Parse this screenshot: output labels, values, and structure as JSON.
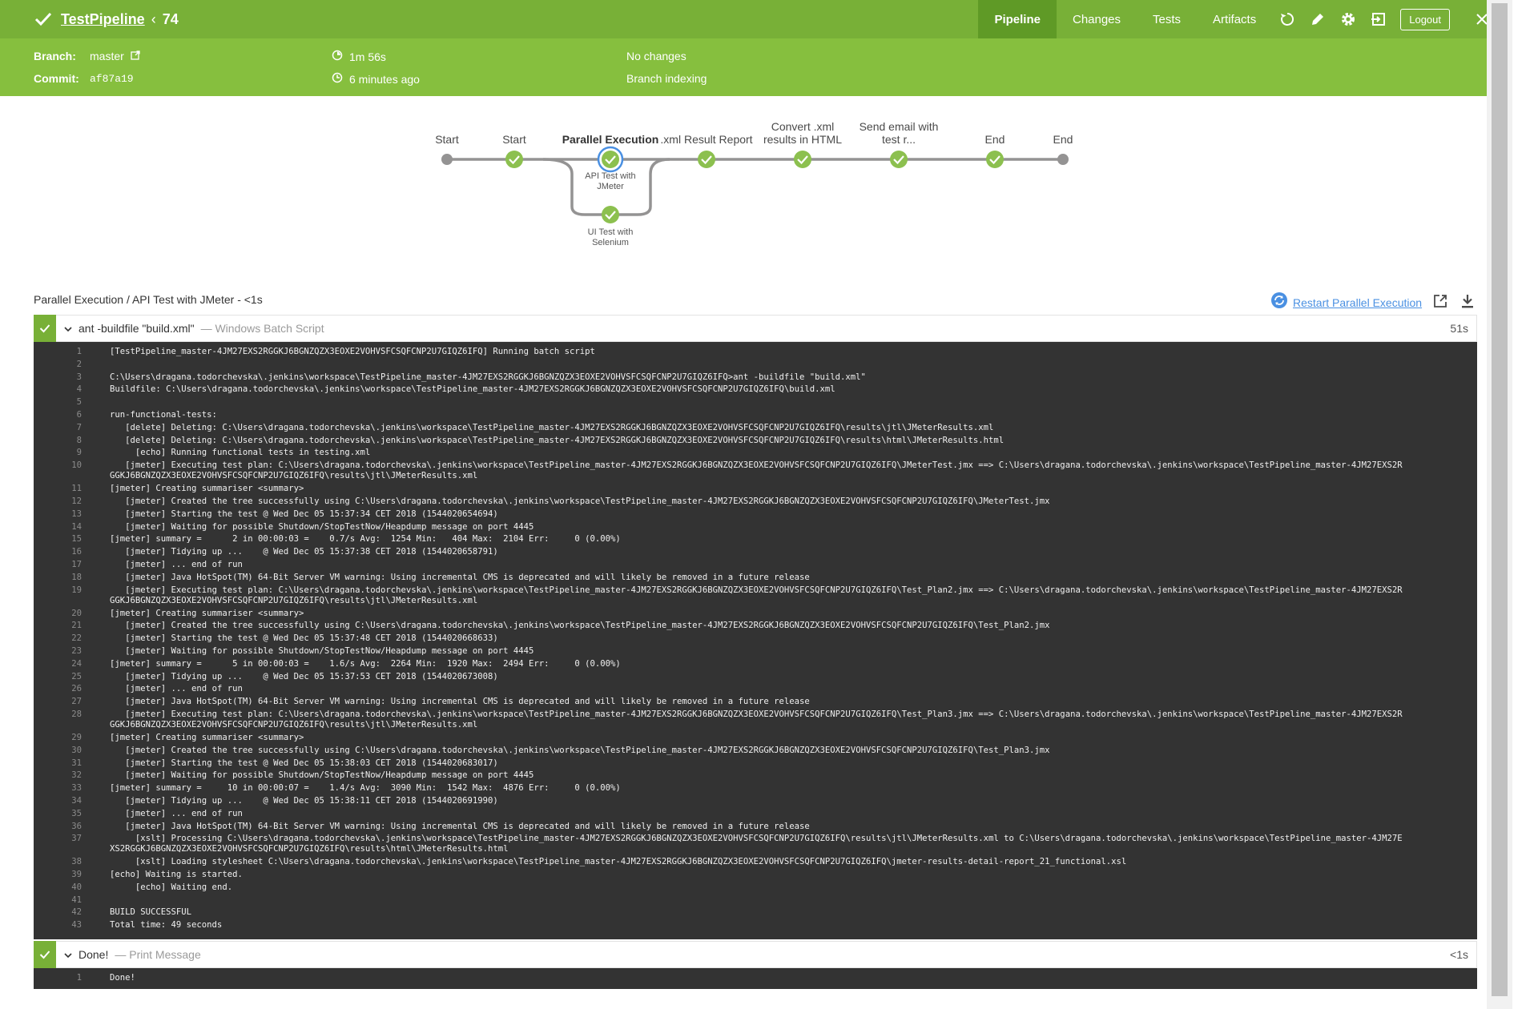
{
  "header": {
    "title": "TestPipeline",
    "run_number": "74",
    "tabs": [
      "Pipeline",
      "Changes",
      "Tests",
      "Artifacts"
    ],
    "logout_label": "Logout"
  },
  "info": {
    "branch_label": "Branch:",
    "branch_value": "master",
    "commit_label": "Commit:",
    "commit_value": "af87a19",
    "duration": "1m 56s",
    "time_ago": "6 minutes ago",
    "changes": "No changes",
    "cause": "Branch indexing"
  },
  "graph": {
    "stages": [
      {
        "label": "Start"
      },
      {
        "label": "Start"
      },
      {
        "label": "Parallel Execution"
      },
      {
        "label": ".xml Result Report"
      },
      {
        "label": "Convert .xml results in HTML"
      },
      {
        "label": "Send email with test r..."
      },
      {
        "label": "End"
      },
      {
        "label": "End"
      }
    ],
    "branches": [
      {
        "label": "API Test with JMeter"
      },
      {
        "label": "UI Test with Selenium"
      }
    ]
  },
  "log_header": {
    "title": "Parallel Execution / API Test with JMeter - <1s",
    "restart_label": "Restart Parallel Execution"
  },
  "steps": [
    {
      "name": "ant -buildfile \"build.xml\"",
      "kind": "— Windows Batch Script",
      "duration": "51s",
      "lines": [
        "[TestPipeline_master-4JM27EXS2RGGKJ6BGNZQZX3EOXE2VOHVSFCSQFCNP2U7GIQZ6IFQ] Running batch script",
        "",
        "C:\\Users\\dragana.todorchevska\\.jenkins\\workspace\\TestPipeline_master-4JM27EXS2RGGKJ6BGNZQZX3EOXE2VOHVSFCSQFCNP2U7GIQZ6IFQ>ant -buildfile \"build.xml\"",
        "Buildfile: C:\\Users\\dragana.todorchevska\\.jenkins\\workspace\\TestPipeline_master-4JM27EXS2RGGKJ6BGNZQZX3EOXE2VOHVSFCSQFCNP2U7GIQZ6IFQ\\build.xml",
        "",
        "run-functional-tests:",
        "   [delete] Deleting: C:\\Users\\dragana.todorchevska\\.jenkins\\workspace\\TestPipeline_master-4JM27EXS2RGGKJ6BGNZQZX3EOXE2VOHVSFCSQFCNP2U7GIQZ6IFQ\\results\\jtl\\JMeterResults.xml",
        "   [delete] Deleting: C:\\Users\\dragana.todorchevska\\.jenkins\\workspace\\TestPipeline_master-4JM27EXS2RGGKJ6BGNZQZX3EOXE2VOHVSFCSQFCNP2U7GIQZ6IFQ\\results\\html\\JMeterResults.html",
        "     [echo] Running functional tests in testing.xml",
        "   [jmeter] Executing test plan: C:\\Users\\dragana.todorchevska\\.jenkins\\workspace\\TestPipeline_master-4JM27EXS2RGGKJ6BGNZQZX3EOXE2VOHVSFCSQFCNP2U7GIQZ6IFQ\\JMeterTest.jmx ==> C:\\Users\\dragana.todorchevska\\.jenkins\\workspace\\TestPipeline_master-4JM27EXS2RGGKJ6BGNZQZX3EOXE2VOHVSFCSQFCNP2U7GIQZ6IFQ\\results\\jtl\\JMeterResults.xml",
        "[jmeter] Creating summariser <summary>",
        "   [jmeter] Created the tree successfully using C:\\Users\\dragana.todorchevska\\.jenkins\\workspace\\TestPipeline_master-4JM27EXS2RGGKJ6BGNZQZX3EOXE2VOHVSFCSQFCNP2U7GIQZ6IFQ\\JMeterTest.jmx",
        "   [jmeter] Starting the test @ Wed Dec 05 15:37:34 CET 2018 (1544020654694)",
        "   [jmeter] Waiting for possible Shutdown/StopTestNow/Heapdump message on port 4445",
        "[jmeter] summary =      2 in 00:00:03 =    0.7/s Avg:  1254 Min:   404 Max:  2104 Err:     0 (0.00%)",
        "   [jmeter] Tidying up ...    @ Wed Dec 05 15:37:38 CET 2018 (1544020658791)",
        "   [jmeter] ... end of run",
        "   [jmeter] Java HotSpot(TM) 64-Bit Server VM warning: Using incremental CMS is deprecated and will likely be removed in a future release",
        "   [jmeter] Executing test plan: C:\\Users\\dragana.todorchevska\\.jenkins\\workspace\\TestPipeline_master-4JM27EXS2RGGKJ6BGNZQZX3EOXE2VOHVSFCSQFCNP2U7GIQZ6IFQ\\Test_Plan2.jmx ==> C:\\Users\\dragana.todorchevska\\.jenkins\\workspace\\TestPipeline_master-4JM27EXS2RGGKJ6BGNZQZX3EOXE2VOHVSFCSQFCNP2U7GIQZ6IFQ\\results\\jtl\\JMeterResults.xml",
        "[jmeter] Creating summariser <summary>",
        "   [jmeter] Created the tree successfully using C:\\Users\\dragana.todorchevska\\.jenkins\\workspace\\TestPipeline_master-4JM27EXS2RGGKJ6BGNZQZX3EOXE2VOHVSFCSQFCNP2U7GIQZ6IFQ\\Test_Plan2.jmx",
        "   [jmeter] Starting the test @ Wed Dec 05 15:37:48 CET 2018 (1544020668633)",
        "   [jmeter] Waiting for possible Shutdown/StopTestNow/Heapdump message on port 4445",
        "[jmeter] summary =      5 in 00:00:03 =    1.6/s Avg:  2264 Min:  1920 Max:  2494 Err:     0 (0.00%)",
        "   [jmeter] Tidying up ...    @ Wed Dec 05 15:37:53 CET 2018 (1544020673008)",
        "   [jmeter] ... end of run",
        "   [jmeter] Java HotSpot(TM) 64-Bit Server VM warning: Using incremental CMS is deprecated and will likely be removed in a future release",
        "   [jmeter] Executing test plan: C:\\Users\\dragana.todorchevska\\.jenkins\\workspace\\TestPipeline_master-4JM27EXS2RGGKJ6BGNZQZX3EOXE2VOHVSFCSQFCNP2U7GIQZ6IFQ\\Test_Plan3.jmx ==> C:\\Users\\dragana.todorchevska\\.jenkins\\workspace\\TestPipeline_master-4JM27EXS2RGGKJ6BGNZQZX3EOXE2VOHVSFCSQFCNP2U7GIQZ6IFQ\\results\\jtl\\JMeterResults.xml",
        "[jmeter] Creating summariser <summary>",
        "   [jmeter] Created the tree successfully using C:\\Users\\dragana.todorchevska\\.jenkins\\workspace\\TestPipeline_master-4JM27EXS2RGGKJ6BGNZQZX3EOXE2VOHVSFCSQFCNP2U7GIQZ6IFQ\\Test_Plan3.jmx",
        "   [jmeter] Starting the test @ Wed Dec 05 15:38:03 CET 2018 (1544020683017)",
        "   [jmeter] Waiting for possible Shutdown/StopTestNow/Heapdump message on port 4445",
        "[jmeter] summary =     10 in 00:00:07 =    1.4/s Avg:  3090 Min:  1542 Max:  4876 Err:     0 (0.00%)",
        "   [jmeter] Tidying up ...    @ Wed Dec 05 15:38:11 CET 2018 (1544020691990)",
        "   [jmeter] ... end of run",
        "   [jmeter] Java HotSpot(TM) 64-Bit Server VM warning: Using incremental CMS is deprecated and will likely be removed in a future release",
        "     [xslt] Processing C:\\Users\\dragana.todorchevska\\.jenkins\\workspace\\TestPipeline_master-4JM27EXS2RGGKJ6BGNZQZX3EOXE2VOHVSFCSQFCNP2U7GIQZ6IFQ\\results\\jtl\\JMeterResults.xml to C:\\Users\\dragana.todorchevska\\.jenkins\\workspace\\TestPipeline_master-4JM27EXS2RGGKJ6BGNZQZX3EOXE2VOHVSFCSQFCNP2U7GIQZ6IFQ\\results\\html\\JMeterResults.html",
        "     [xslt] Loading stylesheet C:\\Users\\dragana.todorchevska\\.jenkins\\workspace\\TestPipeline_master-4JM27EXS2RGGKJ6BGNZQZX3EOXE2VOHVSFCSQFCNP2U7GIQZ6IFQ\\jmeter-results-detail-report_21_functional.xsl",
        "[echo] Waiting is started.",
        "     [echo] Waiting end.",
        "",
        "BUILD SUCCESSFUL",
        "Total time: 49 seconds"
      ]
    },
    {
      "name": "Done!",
      "kind": "— Print Message",
      "duration": "<1s",
      "lines": [
        "Done!"
      ]
    }
  ],
  "colors": {
    "header": "#78b037",
    "infobar": "#86bf3e",
    "success": "#8cc04f",
    "log_bg": "#333333",
    "link": "#4a90e2"
  }
}
